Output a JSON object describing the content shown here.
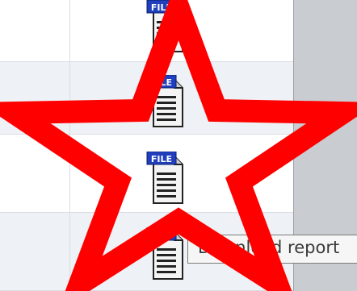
{
  "table": {
    "rows": [
      {
        "icon": "file-icon",
        "badge": "FILE"
      },
      {
        "icon": "file-icon",
        "badge": "FILE"
      },
      {
        "icon": "file-icon",
        "badge": "FILE"
      },
      {
        "icon": "file-icon",
        "badge": "FILE"
      }
    ]
  },
  "tooltip": {
    "text": "Download report"
  },
  "overlay": {
    "shape": "star-outline",
    "color": "#ff0000"
  },
  "colors": {
    "badge": "#1f3fbf",
    "row_alt": "#eef1f5",
    "panel": "#c9cdd1"
  }
}
